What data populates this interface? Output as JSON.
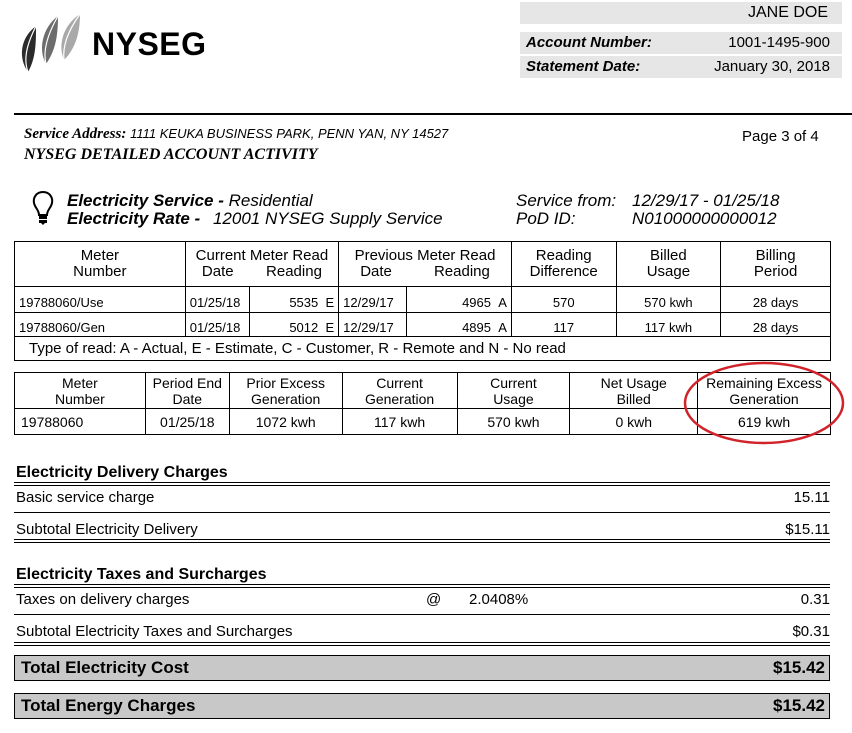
{
  "header": {
    "brand": "NYSEG",
    "customer_name": "JANE DOE",
    "account_label": "Account Number:",
    "account_number": "1001-1495-900",
    "statement_label": "Statement Date:",
    "statement_date": "January 30, 2018"
  },
  "service": {
    "address_label": "Service Address:",
    "address": "1111 KEUKA BUSINESS PARK, PENN YAN, NY 14527",
    "page": "Page 3 of 4",
    "section_title": "NYSEG DETAILED ACCOUNT ACTIVITY",
    "electricity_service_label": "Electricity Service -",
    "electricity_service_value": "Residential",
    "electricity_rate_label": "Electricity Rate -",
    "electricity_rate_value": "12001 NYSEG Supply Service",
    "service_from_label": "Service from:",
    "service_from_value": "12/29/17 - 01/25/18",
    "pod_label": "PoD ID:",
    "pod_value": "N01000000000012"
  },
  "meter_table": {
    "headers": {
      "meter_number": [
        "Meter",
        "Number"
      ],
      "current_read": "Current Meter Read",
      "previous_read": "Previous Meter Read",
      "date": "Date",
      "reading": "Reading",
      "reading_difference": [
        "Reading",
        "Difference"
      ],
      "billed_usage": [
        "Billed",
        "Usage"
      ],
      "billing_period": [
        "Billing",
        "Period"
      ]
    },
    "rows": [
      {
        "meter": "19788060/Use",
        "cur_date": "01/25/18",
        "cur_read": "5535",
        "cur_type": "E",
        "prev_date": "12/29/17",
        "prev_read": "4965",
        "prev_type": "A",
        "difference": "570",
        "usage": "570 kwh",
        "period": "28 days"
      },
      {
        "meter": "19788060/Gen",
        "cur_date": "01/25/18",
        "cur_read": "5012",
        "cur_type": "E",
        "prev_date": "12/29/17",
        "prev_read": "4895",
        "prev_type": "A",
        "difference": "117",
        "usage": "117 kwh",
        "period": "28 days"
      }
    ],
    "legend": "Type of read: A - Actual, E - Estimate, C - Customer, R - Remote and N - No read"
  },
  "net_table": {
    "headers": [
      [
        "Meter",
        "Number"
      ],
      [
        "Period End",
        "Date"
      ],
      [
        "Prior Excess",
        "Generation"
      ],
      [
        "Current",
        "Generation"
      ],
      [
        "Current",
        "Usage"
      ],
      [
        "Net Usage",
        "Billed"
      ],
      [
        "Remaining Excess",
        "Generation"
      ]
    ],
    "row": [
      "19788060",
      "01/25/18",
      "1072 kwh",
      "117 kwh",
      "570 kwh",
      "0 kwh",
      "619 kwh"
    ]
  },
  "delivery": {
    "title": "Electricity Delivery Charges",
    "basic_label": "Basic service charge",
    "basic_value": "15.11",
    "subtotal_label": "Subtotal Electricity Delivery",
    "subtotal_value": "$15.11"
  },
  "taxes": {
    "title": "Electricity Taxes and Surcharges",
    "line_label": "Taxes on delivery charges",
    "at": "@",
    "rate": "2.0408%",
    "line_value": "0.31",
    "subtotal_label": "Subtotal Electricity Taxes and Surcharges",
    "subtotal_value": "$0.31"
  },
  "totals": {
    "electricity_label": "Total Electricity Cost",
    "electricity_value": "$15.42",
    "energy_label": "Total Energy Charges",
    "energy_value": "$15.42"
  },
  "colors": {
    "highlight_circle": "#d0232a",
    "header_shade": "#e6e6e6",
    "total_shade": "#c8c8c8"
  }
}
